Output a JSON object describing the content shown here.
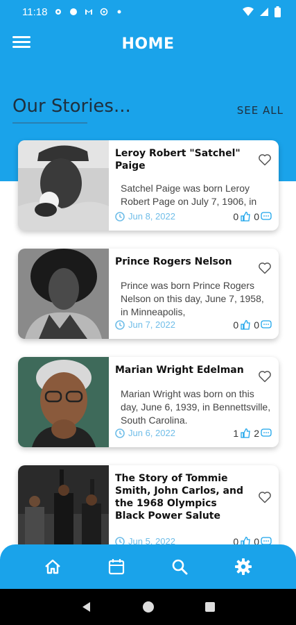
{
  "status_bar": {
    "time": "11:18"
  },
  "app_bar": {
    "title": "HOME"
  },
  "section": {
    "title": "Our Stories...",
    "see_all": "SEE ALL"
  },
  "stories": [
    {
      "title": "Leroy Robert \"Satchel\" Paige",
      "excerpt": "Satchel Paige was born Leroy Robert Page on July 7, 1906, in",
      "date": "Jun 8, 2022",
      "likes": "0",
      "comments": "0"
    },
    {
      "title": "Prince Rogers Nelson",
      "excerpt": "Prince was born Prince Rogers Nelson on this day, June 7, 1958, in Minneapolis,",
      "date": "Jun 7, 2022",
      "likes": "0",
      "comments": "0"
    },
    {
      "title": "Marian Wright Edelman",
      "excerpt": "Marian Wright was born on this day, June 6, 1939, in Bennettsville, South Carolina.",
      "date": "Jun 6, 2022",
      "likes": "1",
      "comments": "2"
    },
    {
      "title": "The Story of Tommie Smith, John Carlos, and the 1968 Olympics Black Power Salute",
      "excerpt": "",
      "date": "Jun 5, 2022",
      "likes": "0",
      "comments": "0"
    }
  ],
  "bottom_nav": [
    "home-icon",
    "calendar-icon",
    "search-icon",
    "gear-icon"
  ],
  "colors": {
    "primary": "#1aa3ea",
    "date": "#6fbde8",
    "text": "#1f2f3d"
  }
}
